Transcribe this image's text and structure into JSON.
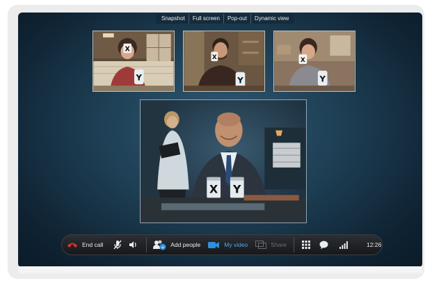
{
  "toolbar": {
    "snapshot": "Snapshot",
    "full_screen": "Full screen",
    "pop_out": "Pop-out",
    "dynamic_view": "Dynamic view"
  },
  "participants": {
    "thumb1": {
      "cup_label": "X",
      "can_label": "Y"
    },
    "thumb2": {
      "cup_label": "X",
      "can_label": "Y"
    },
    "thumb3": {
      "cup_label": "X",
      "can_label": "Y"
    },
    "main": {
      "can_left_label": "X",
      "can_right_label": "Y"
    }
  },
  "callbar": {
    "end_call": "End call",
    "add_people": "Add people",
    "my_video": "My video",
    "share": "Share",
    "time": "12:26"
  },
  "icons": {
    "end_call": "phone-hangup-icon",
    "mute": "microphone-muted-icon",
    "volume": "speaker-icon",
    "add_people": "add-people-icon",
    "my_video": "video-camera-icon",
    "share": "share-screen-icon",
    "dialpad": "dialpad-icon",
    "chat": "chat-bubble-icon",
    "signal": "signal-strength-icon"
  },
  "colors": {
    "end_call_red": "#e0302a",
    "video_blue": "#2f8fe0",
    "stage_center": "#2f5a74",
    "stage_edge": "#0b1b28"
  }
}
